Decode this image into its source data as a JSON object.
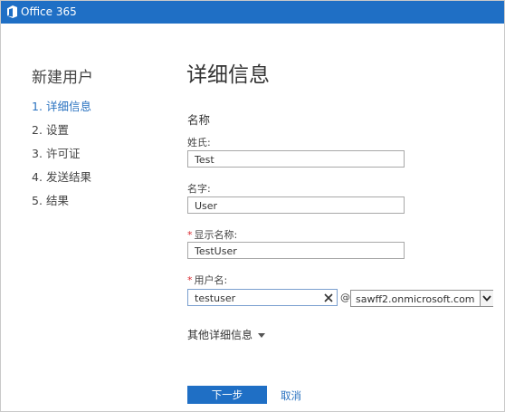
{
  "app": {
    "brand": "Office 365"
  },
  "wizard": {
    "title": "新建用户",
    "steps": [
      {
        "num": "1.",
        "label": "详细信息"
      },
      {
        "num": "2.",
        "label": "设置"
      },
      {
        "num": "3.",
        "label": "许可证"
      },
      {
        "num": "4.",
        "label": "发送结果"
      },
      {
        "num": "5.",
        "label": "结果"
      }
    ]
  },
  "page": {
    "title": "详细信息",
    "section": "名称",
    "last_name": {
      "label": "姓氏:",
      "value": "Test"
    },
    "first_name": {
      "label": "名字:",
      "value": "User"
    },
    "display_name": {
      "label": "显示名称:",
      "value": "TestUser",
      "required_mark": "*"
    },
    "user_name": {
      "label": "用户名:",
      "value": "testuser",
      "required_mark": "*"
    },
    "at": "@",
    "domain": {
      "selected": "sawff2.onmicrosoft.com"
    },
    "more_details": "其他详细信息"
  },
  "actions": {
    "next": "下一步",
    "cancel": "取消"
  },
  "colors": {
    "brand": "#1f6fc5",
    "link": "#2a72c0",
    "required": "#d9272e"
  }
}
